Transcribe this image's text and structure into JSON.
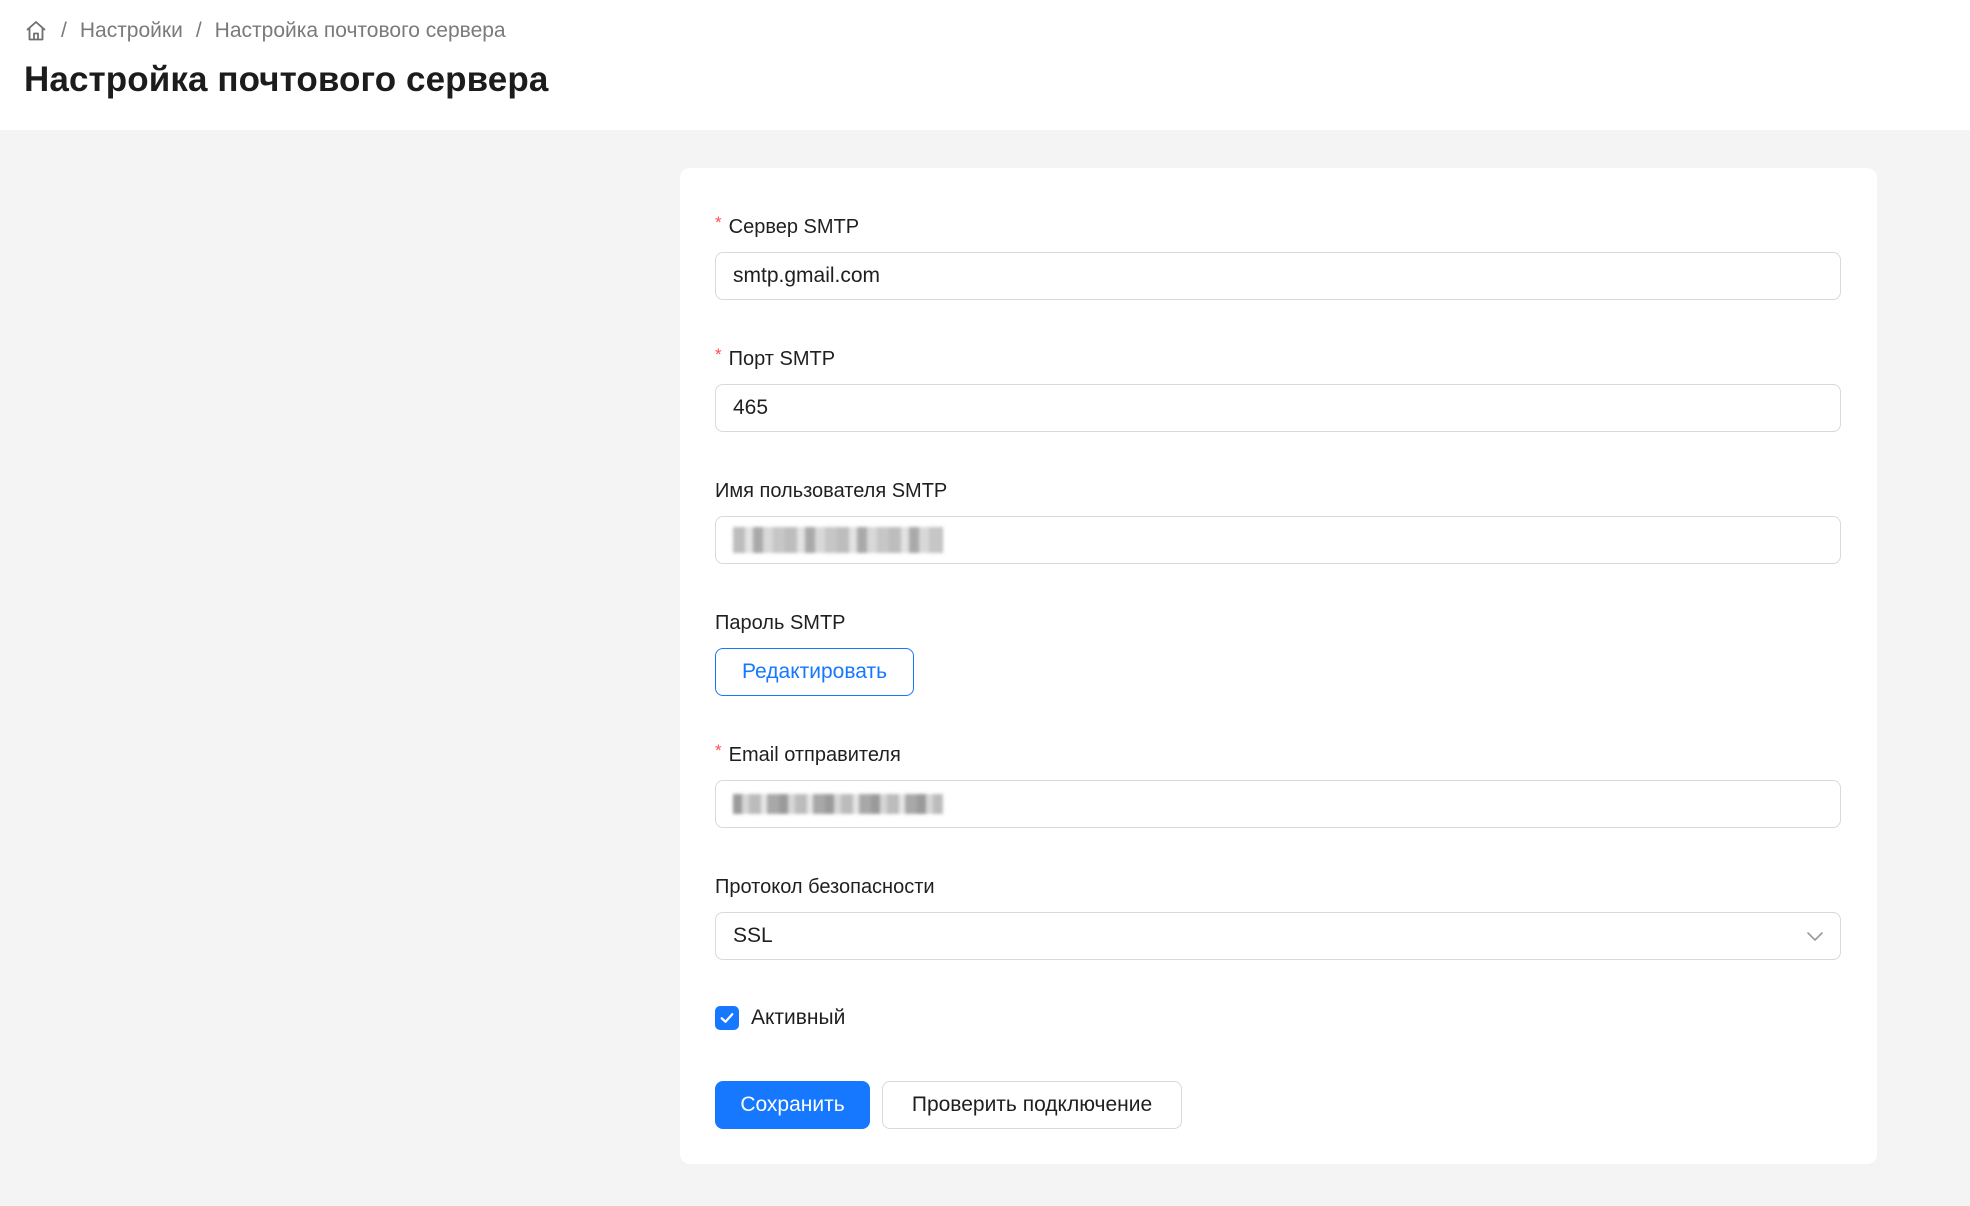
{
  "breadcrumb": {
    "home_icon": "home-icon",
    "items": [
      "Настройки",
      "Настройка почтового сервера"
    ]
  },
  "page_title": "Настройка почтового сервера",
  "form": {
    "smtp_server": {
      "label": "Сервер SMTP",
      "required": true,
      "value": "smtp.gmail.com"
    },
    "smtp_port": {
      "label": "Порт SMTP",
      "required": true,
      "value": "465"
    },
    "smtp_username": {
      "label": "Имя пользователя SMTP",
      "required": false
    },
    "smtp_password": {
      "label": "Пароль SMTP",
      "edit_button": "Редактировать"
    },
    "sender_email": {
      "label": "Email отправителя",
      "required": true
    },
    "security_protocol": {
      "label": "Протокол безопасности",
      "value": "SSL",
      "arrow_icon": "chevron-down-icon"
    },
    "active": {
      "label": "Активный",
      "checked": true
    }
  },
  "actions": {
    "save": "Сохранить",
    "test_connection": "Проверить подключение"
  },
  "colors": {
    "primary": "#1677ff",
    "required": "#ff4d4f",
    "background": "#f4f4f4"
  }
}
